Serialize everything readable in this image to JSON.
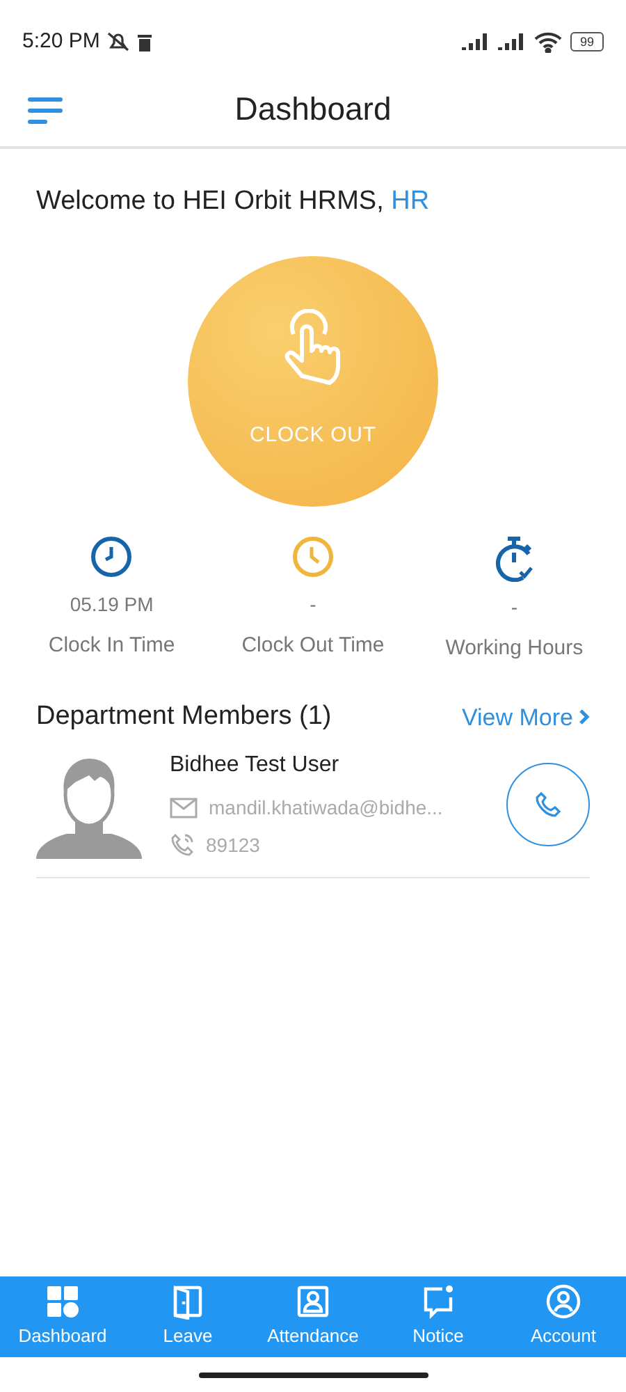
{
  "status_bar": {
    "time": "5:20 PM",
    "battery": "99"
  },
  "header": {
    "title": "Dashboard"
  },
  "welcome": {
    "text": "Welcome to HEI Orbit HRMS, ",
    "role": "HR"
  },
  "clock_button": {
    "label": "CLOCK OUT"
  },
  "stats": [
    {
      "kind": "clock-in",
      "value": "05.19 PM",
      "label": "Clock In Time"
    },
    {
      "kind": "clock-out",
      "value": "-",
      "label": "Clock Out Time"
    },
    {
      "kind": "timer",
      "value": "-",
      "label": "Working Hours"
    }
  ],
  "department": {
    "title": "Department Members (1)",
    "view_more": "View More",
    "members": [
      {
        "name": "Bidhee Test User",
        "email": "mandil.khatiwada@bidhe...",
        "phone": "89123"
      }
    ]
  },
  "bottom_nav": [
    {
      "kind": "dashboard",
      "label": "Dashboard"
    },
    {
      "kind": "leave",
      "label": "Leave"
    },
    {
      "kind": "attendance",
      "label": "Attendance"
    },
    {
      "kind": "notice",
      "label": "Notice"
    },
    {
      "kind": "account",
      "label": "Account"
    }
  ]
}
